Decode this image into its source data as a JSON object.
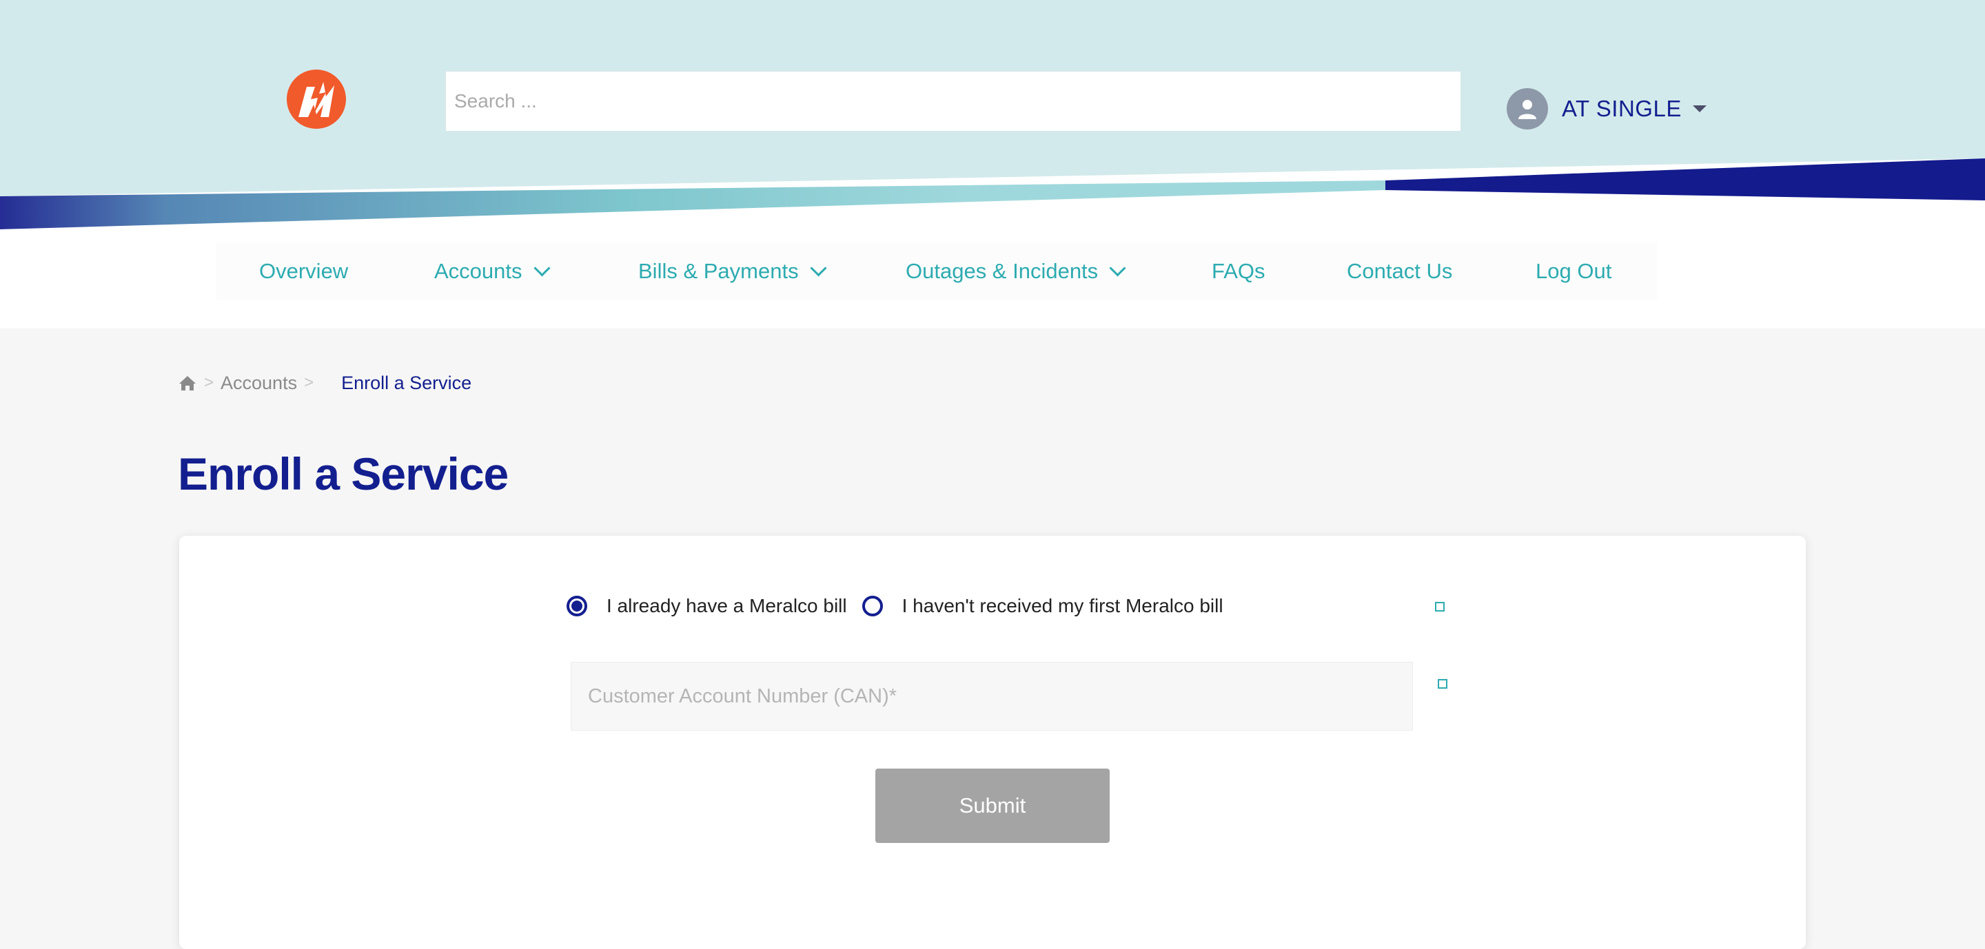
{
  "header": {
    "logo_name": "meralco-logo",
    "search_placeholder": "Search ...",
    "user_name": "AT SINGLE"
  },
  "nav": {
    "items": [
      {
        "label": "Overview"
      },
      {
        "label": "Accounts"
      },
      {
        "label": "Bills & Payments"
      },
      {
        "label": "Outages & Incidents"
      },
      {
        "label": "FAQs"
      },
      {
        "label": "Contact Us"
      },
      {
        "label": "Log Out"
      }
    ]
  },
  "breadcrumb": {
    "home_icon": "home-icon",
    "parent": "Accounts",
    "separator": ">",
    "current": "Enroll a Service"
  },
  "page": {
    "title": "Enroll a Service"
  },
  "form": {
    "radio_options": [
      {
        "label": "I already have a Meralco bill",
        "selected": true
      },
      {
        "label": "I haven't received my first Meralco bill",
        "selected": false
      }
    ],
    "can_placeholder": "Customer Account Number (CAN)*",
    "submit_label": "Submit"
  },
  "colors": {
    "brand_navy": "#131f8f",
    "accent_teal": "#2cabb0",
    "header_bg": "#d3eaec",
    "logo_orange": "#f15a2b",
    "submit_disabled": "#a4a4a4"
  }
}
